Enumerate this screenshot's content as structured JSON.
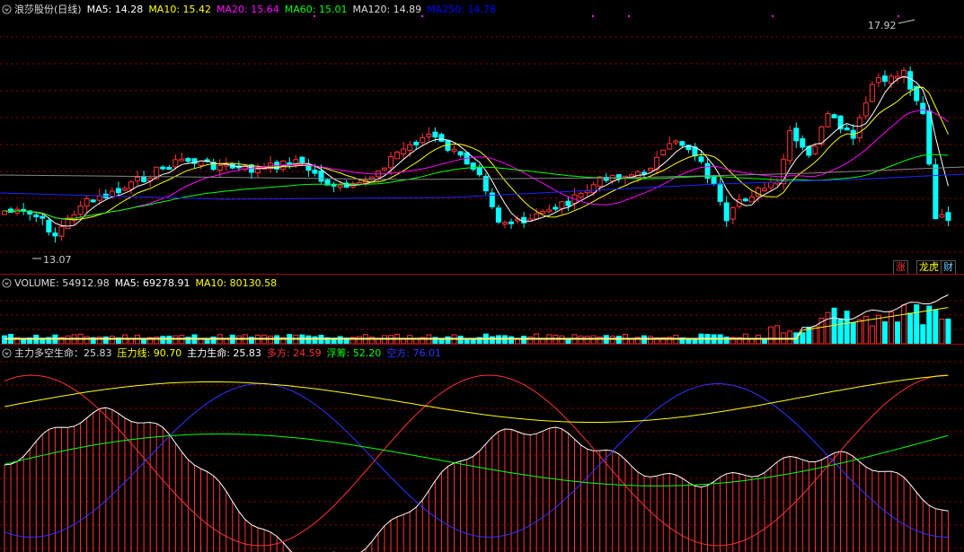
{
  "header": {
    "stock_name": "浪莎股份(日线)",
    "ma_items": [
      {
        "label": "MA5: 14.28",
        "color": "#ffffff"
      },
      {
        "label": "MA10: 15.42",
        "color": "#ffff00"
      },
      {
        "label": "MA20: 15.64",
        "color": "#ff00ff"
      },
      {
        "label": "MA60: 15.01",
        "color": "#00ff00"
      },
      {
        "label": "MA120: 14.89",
        "color": "#dddddd"
      },
      {
        "label": "MA250: 14.78",
        "color": "#0000ff"
      }
    ]
  },
  "price_marks": {
    "high": "17.92",
    "low": "13.07"
  },
  "badges": [
    {
      "text": "涨",
      "color": "#ff3333"
    },
    {
      "text": "龙虎",
      "color": "#ffff00"
    },
    {
      "text": "财",
      "color": "#66ccff"
    }
  ],
  "volume_header": [
    {
      "label": "VOLUME: 54912.98",
      "color": "#dddddd"
    },
    {
      "label": "MA5: 69278.91",
      "color": "#ffffff"
    },
    {
      "label": "MA10: 80130.58",
      "color": "#ffff00"
    }
  ],
  "indicator_header": [
    {
      "label": "主力多空生命：25.83",
      "color": "#dddddd"
    },
    {
      "label": "压力线: 90.70",
      "color": "#ffff00"
    },
    {
      "label": "主力生命: 25.83",
      "color": "#ffffff"
    },
    {
      "label": "多方: 24.59",
      "color": "#ff3333"
    },
    {
      "label": "浮筹: 52.20",
      "color": "#00ff00"
    },
    {
      "label": "空方: 76.01",
      "color": "#3333ff"
    }
  ],
  "icons": {
    "settings": "gear-icon"
  },
  "colors": {
    "up": "#ff3333",
    "down": "#00ffff",
    "grid": "#a00000",
    "bg": "#000000"
  }
}
